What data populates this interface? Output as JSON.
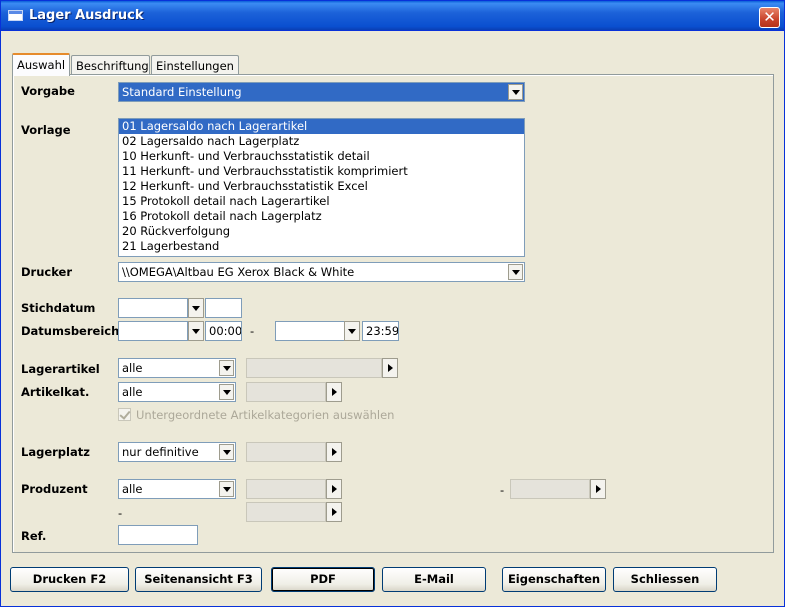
{
  "window": {
    "title": "Lager Ausdruck",
    "close_glyph": "✕"
  },
  "tabs": [
    "Auswahl",
    "Beschriftung",
    "Einstellungen"
  ],
  "labels": {
    "vorgabe": "Vorgabe",
    "vorlage": "Vorlage",
    "drucker": "Drucker",
    "stichdatum": "Stichdatum",
    "datumsbereich": "Datumsbereich",
    "lagerartikel": "Lagerartikel",
    "artikelkat": "Artikelkat.",
    "lagerplatz": "Lagerplatz",
    "produzent": "Produzent",
    "ref": "Ref."
  },
  "fields": {
    "vorgabe": "Standard Einstellung",
    "drucker": "\\\\OMEGA\\Altbau EG Xerox Black & White",
    "stichdatum_date": "",
    "stichdatum_time": "",
    "range_from_date": "",
    "range_from_time": "00:00",
    "range_to_date": "",
    "range_to_time": "23:59",
    "range_dash": "-",
    "lagerartikel": "alle",
    "artikelkat": "alle",
    "lagerplatz": "nur definitive",
    "produzent": "alle",
    "produzent_dash_right": "-",
    "produzent_dash_bottom": "-",
    "ref": ""
  },
  "vorlage_items": [
    "01 Lagersaldo nach Lagerartikel",
    "02 Lagersaldo nach Lagerplatz",
    "10 Herkunft- und Verbrauchsstatistik detail",
    "11 Herkunft- und Verbrauchsstatistik komprimiert",
    "12 Herkunft- und Verbrauchsstatistik Excel",
    "15 Protokoll detail nach Lagerartikel",
    "16 Protokoll detail nach Lagerplatz",
    "20 Rückverfolgung",
    "21 Lagerbestand"
  ],
  "checkbox": {
    "label": "Untergeordnete Artikelkategorien auswählen",
    "checked": true,
    "enabled": false
  },
  "buttons": {
    "drucken": "Drucken F2",
    "seitenansicht": "Seitenansicht F3",
    "pdf": "PDF",
    "email": "E-Mail",
    "eigenschaften": "Eigenschaften",
    "schliessen": "Schliessen"
  }
}
